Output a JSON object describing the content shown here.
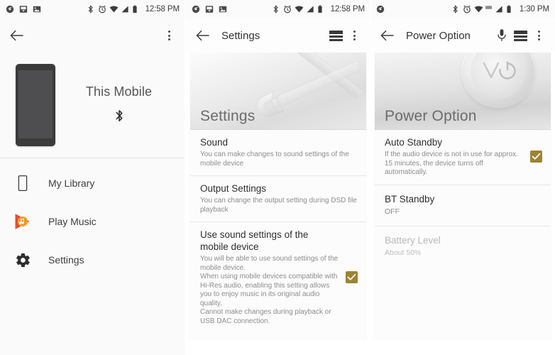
{
  "panels": [
    {
      "id": "device-panel",
      "statusbar": {
        "left_icons": [
          "browser-icon",
          "download-icon",
          "image-icon"
        ],
        "right_icons": [
          "bluetooth-icon",
          "alarm-icon",
          "wifi-icon",
          "signal-icon",
          "battery-icon"
        ],
        "time": "12:58 PM"
      },
      "appbar": {
        "back_icon": "back-arrow-icon",
        "title": "",
        "overflow_icon": "more-vertical-icon"
      },
      "device": {
        "image_name": "smartphone-illustration",
        "name": "This Mobile",
        "connection_icon": "bluetooth-icon"
      },
      "nav_items": [
        {
          "icon": "smartphone-icon",
          "label": "My Library"
        },
        {
          "icon": "play-music-icon",
          "label": "Play Music"
        },
        {
          "icon": "gear-icon",
          "label": "Settings"
        }
      ]
    },
    {
      "id": "settings-panel",
      "statusbar": {
        "left_icons": [
          "browser-icon",
          "download-icon",
          "image-icon"
        ],
        "right_icons": [
          "bluetooth-icon",
          "alarm-icon",
          "wifi-icon",
          "signal-icon",
          "battery-icon"
        ],
        "time": "12:58 PM"
      },
      "appbar": {
        "back_icon": "back-arrow-icon",
        "title": "Settings",
        "equalizer_icon": "equalizer-icon",
        "overflow_icon": "more-vertical-icon"
      },
      "hero": {
        "image_name": "wrenches-illustration",
        "title": "Settings"
      },
      "rows": [
        {
          "title": "Sound",
          "desc": "You can make changes to sound settings of the mobile device",
          "checkbox": null
        },
        {
          "title": "Output Settings",
          "desc": "You can change the output setting during DSD file playback",
          "checkbox": null
        },
        {
          "title": "Use sound settings of the mobile device",
          "desc": "You will be able to use sound settings of the mobile device.\nWhen using mobile devices compatible with Hi-Res audio, enabling this setting allows you to enjoy music in its original audio quality.\nCannot make changes during playback or USB DAC connection.",
          "checkbox": "checked"
        }
      ]
    },
    {
      "id": "power-option-panel",
      "statusbar": {
        "left_icons": [
          "browser-icon"
        ],
        "right_icons": [
          "bluetooth-icon",
          "alarm-icon",
          "wifi-icon",
          "hd-icon",
          "signal-icon",
          "battery-icon"
        ],
        "time": "1:30 PM"
      },
      "appbar": {
        "back_icon": "back-arrow-icon",
        "title": "Power Option",
        "mic_icon": "microphone-icon",
        "equalizer_icon": "equalizer-icon",
        "overflow_icon": "more-vertical-icon"
      },
      "hero": {
        "image_name": "power-button-illustration",
        "title": "Power Option"
      },
      "rows": [
        {
          "title": "Auto Standby",
          "desc": "If the audio device is not in use for approx. 15 minutes, the device turns off automatically.",
          "checkbox": "checked"
        },
        {
          "title": "BT Standby",
          "value": "OFF",
          "checkbox": null
        },
        {
          "title": "Battery Level",
          "value": "About 50%",
          "checkbox": null,
          "disabled": true
        }
      ]
    }
  ],
  "colors": {
    "checkbox_gold": "#9d8433",
    "play_music_red": "#e8402a",
    "play_music_orange": "#f7a823",
    "app_background": "#fafafa",
    "text_primary": "#2f2f2f",
    "text_secondary": "#8c8c8c"
  }
}
